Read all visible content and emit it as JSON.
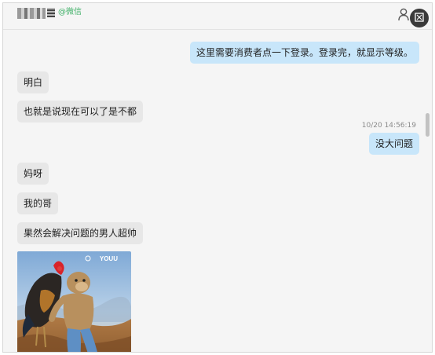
{
  "header": {
    "wechat_tag": "@微信"
  },
  "messages": [
    {
      "direction": "out",
      "text": "这里需要消费者点一下登录。登录完，就显示等级。"
    },
    {
      "direction": "in",
      "text": "明白"
    },
    {
      "direction": "in",
      "text": "也就是说现在可以了是不都"
    },
    {
      "direction": "out",
      "text": "没大问题"
    },
    {
      "direction": "in",
      "text": "妈呀"
    },
    {
      "direction": "in",
      "text": "我的哥"
    },
    {
      "direction": "in",
      "text": "果然会解决问题的男人超帅"
    }
  ],
  "timestamp": "10/20 14:56:19",
  "image_message": {
    "watermark": "YOUU",
    "icon": "monkey-with-rooster-photo"
  },
  "icons": {
    "header_person": "person-icon",
    "header_action": "screenshot-icon"
  },
  "colors": {
    "outgoing_bubble": "#c8e6fa",
    "incoming_bubble": "#e7e7e7",
    "wechat_tag": "#3fb067"
  }
}
